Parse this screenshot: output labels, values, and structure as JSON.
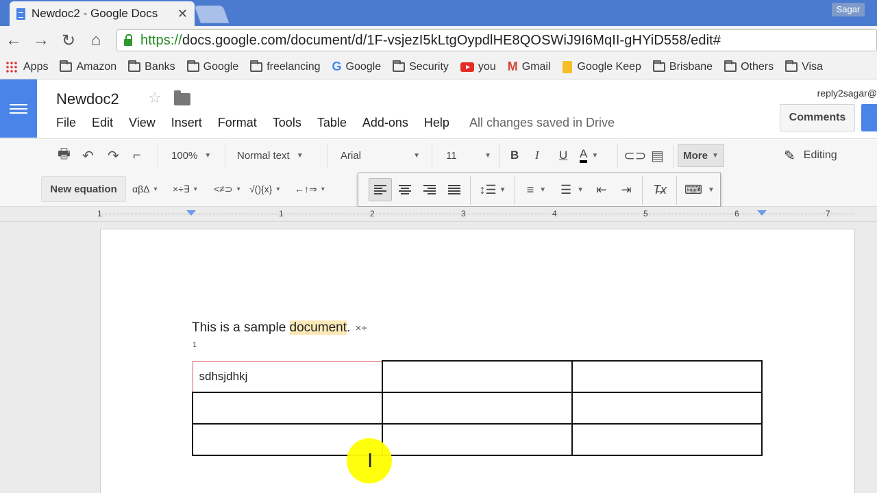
{
  "browser": {
    "tab_title": "Newdoc2 - Google Docs",
    "profile_name": "Sagar",
    "url_secure": "https://",
    "url_host": "docs.google.com",
    "url_path": "/document/d/1F-vsjezI5kLtgOypdlHE8QOSWiJ9I6MqII-gHYiD558/edit#"
  },
  "bookmarks": [
    {
      "label": "Apps",
      "icon": "apps-icon"
    },
    {
      "label": "Amazon",
      "icon": "folder-icon"
    },
    {
      "label": "Banks",
      "icon": "folder-icon"
    },
    {
      "label": "Google",
      "icon": "folder-icon"
    },
    {
      "label": "freelancing",
      "icon": "folder-icon"
    },
    {
      "label": "Google",
      "icon": "google-icon"
    },
    {
      "label": "Security",
      "icon": "folder-icon"
    },
    {
      "label": "you",
      "icon": "youtube-icon"
    },
    {
      "label": "Gmail",
      "icon": "gmail-icon"
    },
    {
      "label": "Google Keep",
      "icon": "keep-icon"
    },
    {
      "label": "Brisbane",
      "icon": "folder-icon"
    },
    {
      "label": "Others",
      "icon": "folder-icon"
    },
    {
      "label": "Visa",
      "icon": "folder-icon"
    }
  ],
  "docs": {
    "title": "Newdoc2",
    "user_email": "reply2sagar@",
    "menu": [
      "File",
      "Edit",
      "View",
      "Insert",
      "Format",
      "Tools",
      "Table",
      "Add-ons",
      "Help"
    ],
    "save_status": "All changes saved in Drive",
    "comments_label": "Comments"
  },
  "toolbar": {
    "zoom": "100%",
    "style": "Normal text",
    "font": "Arial",
    "size": "11",
    "more_label": "More",
    "editing_label": "Editing"
  },
  "equation_bar": {
    "new_equation_label": "New equation",
    "symbols": [
      "αβΔ",
      "×÷∃",
      "<≠⊃",
      "√(){x}",
      "←↑⇒"
    ]
  },
  "ruler": {
    "numbers": [
      "1",
      "1",
      "2",
      "3",
      "4",
      "5",
      "6",
      "7"
    ]
  },
  "document": {
    "text_before": "This is a sample ",
    "text_highlight": "document",
    "text_after": ". ",
    "inline_equation": "×÷",
    "footnote": "1",
    "table": [
      [
        "sdhsjdhkj",
        "",
        ""
      ],
      [
        "",
        "",
        ""
      ],
      [
        "",
        "",
        ""
      ]
    ]
  },
  "colors": {
    "docs_blue": "#4a84e8",
    "highlight": "#fbe9b7",
    "cursor_spot": "#ffff00"
  }
}
